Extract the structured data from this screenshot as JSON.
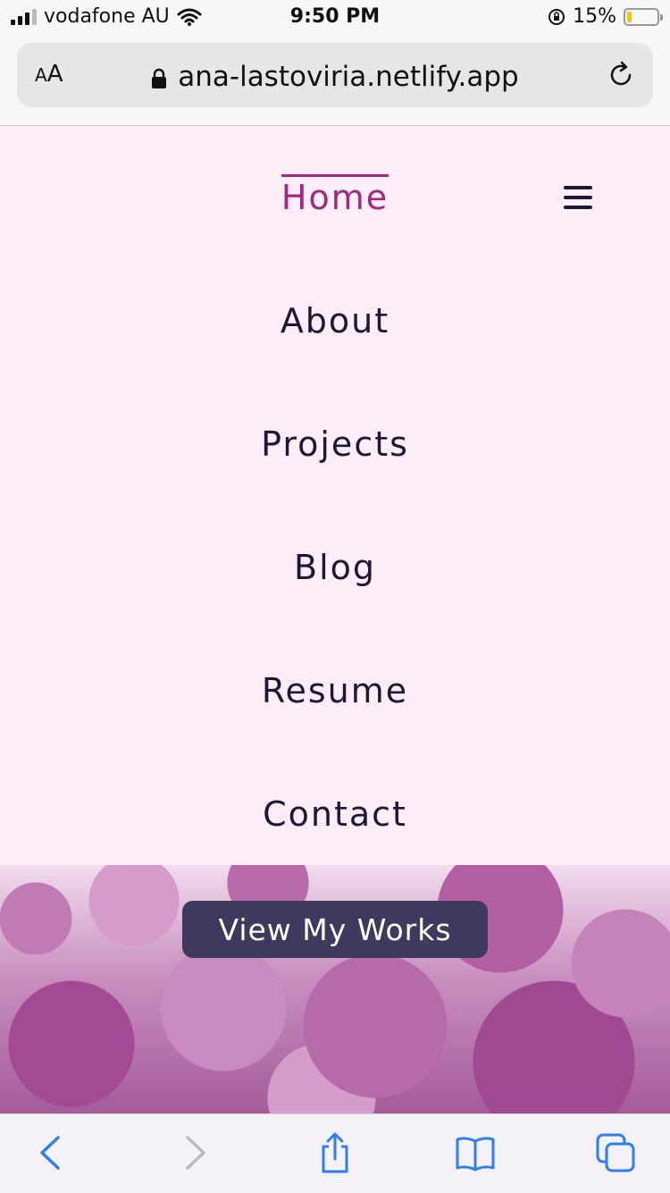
{
  "status_bar": {
    "carrier": "vodafone AU",
    "time": "9:50 PM",
    "battery_percent": "15%",
    "battery_level": 0.15,
    "icons": [
      "signal-icon",
      "wifi-icon",
      "rotation-lock-icon",
      "battery-icon"
    ]
  },
  "browser": {
    "text_size_button": "AA",
    "url": "ana-lastoviria.netlify.app",
    "icons": [
      "lock-icon",
      "reload-icon"
    ]
  },
  "nav": {
    "items": [
      {
        "label": "Home",
        "active": true
      },
      {
        "label": "About",
        "active": false
      },
      {
        "label": "Projects",
        "active": false
      },
      {
        "label": "Blog",
        "active": false
      },
      {
        "label": "Resume",
        "active": false
      },
      {
        "label": "Contact",
        "active": false
      }
    ],
    "menu_icon": "hamburger-icon"
  },
  "hero": {
    "button_label": "View My Works"
  },
  "toolbar": {
    "icons": [
      "back-icon",
      "forward-icon",
      "share-icon",
      "bookmarks-icon",
      "tabs-icon"
    ]
  },
  "colors": {
    "page_background": "#fcedf7",
    "nav_text": "#1d1838",
    "active_accent": "#a0287f",
    "button_background": "#3e3a5e",
    "link_blue": "#2e7cf6"
  }
}
